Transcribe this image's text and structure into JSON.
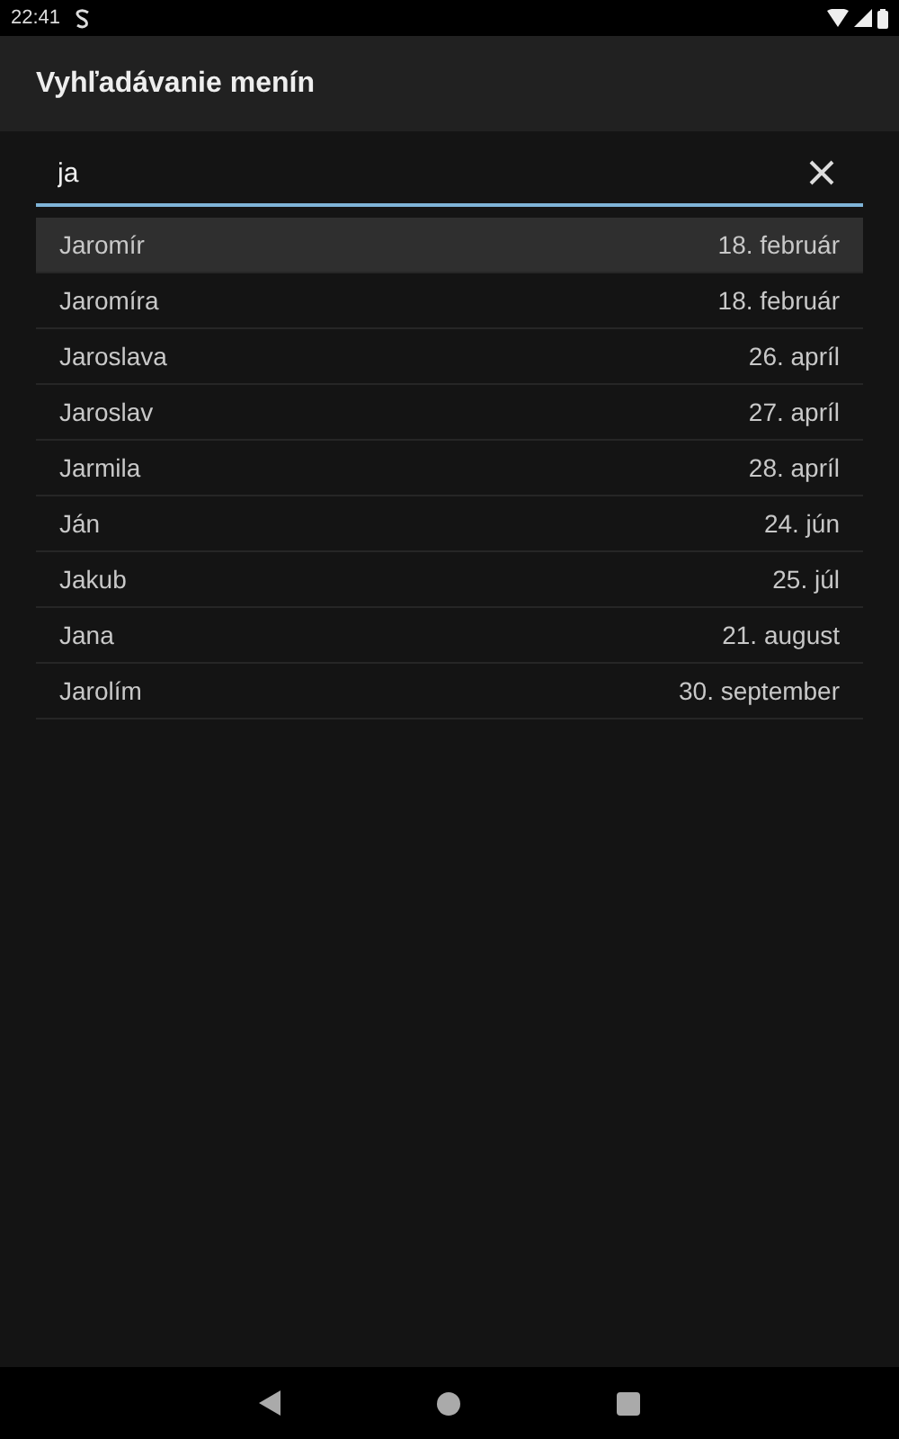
{
  "status_bar": {
    "time": "22:41"
  },
  "app_bar": {
    "title": "Vyhľadávanie menín"
  },
  "search": {
    "value": "ja"
  },
  "results": [
    {
      "name": "Jaromír",
      "date": "18. február",
      "selected": true
    },
    {
      "name": "Jaromíra",
      "date": "18. február",
      "selected": false
    },
    {
      "name": "Jaroslava",
      "date": "26. apríl",
      "selected": false
    },
    {
      "name": "Jaroslav",
      "date": "27. apríl",
      "selected": false
    },
    {
      "name": "Jarmila",
      "date": "28. apríl",
      "selected": false
    },
    {
      "name": "Ján",
      "date": "24. jún",
      "selected": false
    },
    {
      "name": "Jakub",
      "date": "25. júl",
      "selected": false
    },
    {
      "name": "Jana",
      "date": "21. august",
      "selected": false
    },
    {
      "name": "Jarolím",
      "date": "30. september",
      "selected": false
    }
  ]
}
